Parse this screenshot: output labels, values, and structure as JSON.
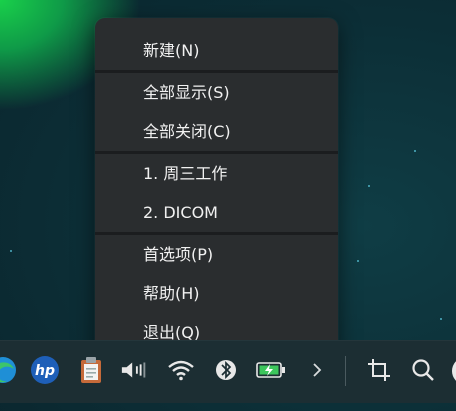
{
  "context_menu": {
    "new": "新建(N)",
    "show_all": "全部显示(S)",
    "close_all": "全部关闭(C)",
    "note_1": "1. 周三工作",
    "note_2": "2. DICOM",
    "preferences": "首选项(P)",
    "help": "帮助(H)",
    "quit": "退出(Q)"
  },
  "taskbar": {
    "icons": [
      "edge-icon",
      "hp-icon",
      "clipboard-icon",
      "volume-icon",
      "wifi-icon",
      "bluetooth-icon",
      "battery-charging-icon",
      "chevron-right-icon",
      "crop-icon",
      "search-icon"
    ],
    "accent": "#3cc65c"
  }
}
